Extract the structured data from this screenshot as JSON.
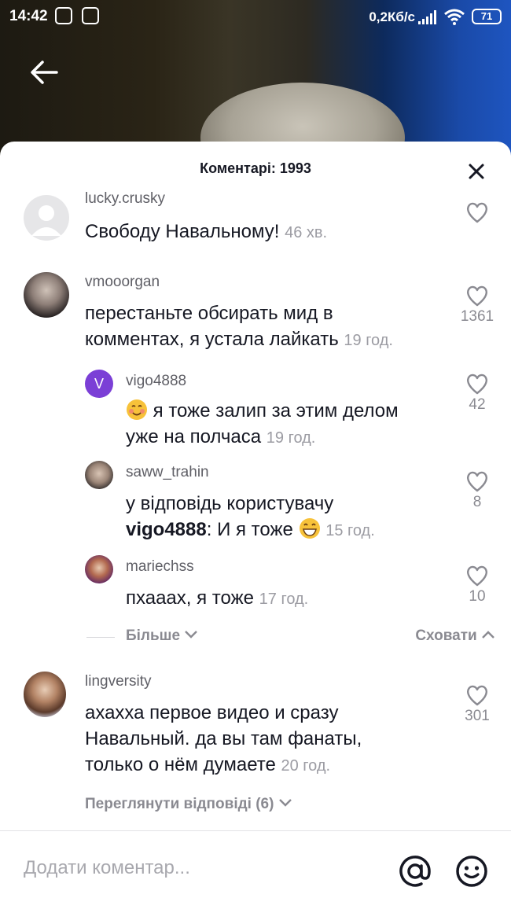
{
  "status_bar": {
    "time": "14:42",
    "network_speed": "0,2Кб/с",
    "battery": "71"
  },
  "sheet": {
    "title": "Коментарі: 1993"
  },
  "comments": [
    {
      "username": "lucky.crusky",
      "text": "Свободу Навальному!",
      "time": "46 хв.",
      "likes": ""
    },
    {
      "username": "vmooorgan",
      "text_line1": "перестаньте обсирать мид в",
      "text_line2": "комментах, я устала лайкать",
      "time": "19 год.",
      "likes": "1361"
    },
    {
      "username": "vigo4888",
      "avatar_letter": "V",
      "text_line1": "я тоже залип за этим делом",
      "text_line2": "уже на полчаса",
      "time": "19 год.",
      "likes": "42"
    },
    {
      "username": "saww_trahin",
      "text_line1": "у відповідь користувачу",
      "mention": "vigo4888",
      "text_line2_rest": ": И я тоже",
      "time": "15 год.",
      "likes": "8"
    },
    {
      "username": "mariechss",
      "text": "пхааах, я тоже",
      "time": "17 год.",
      "likes": "10"
    },
    {
      "username": "lingversity",
      "text_line1": "ахахха первое видео и сразу",
      "text_line2": "Навальный. да вы там фанаты,",
      "text_line3": "только о нём думаете",
      "time": "20 год.",
      "likes": "301"
    }
  ],
  "replies_controls": {
    "more_label": "Більше",
    "hide_label": "Сховати",
    "view_replies_label": "Переглянути відповіді (6)"
  },
  "input": {
    "placeholder": "Додати коментар..."
  },
  "colors": {
    "accent_purple": "#7b3fd6",
    "text_primary": "#161823",
    "text_secondary": "#8a8a91"
  }
}
